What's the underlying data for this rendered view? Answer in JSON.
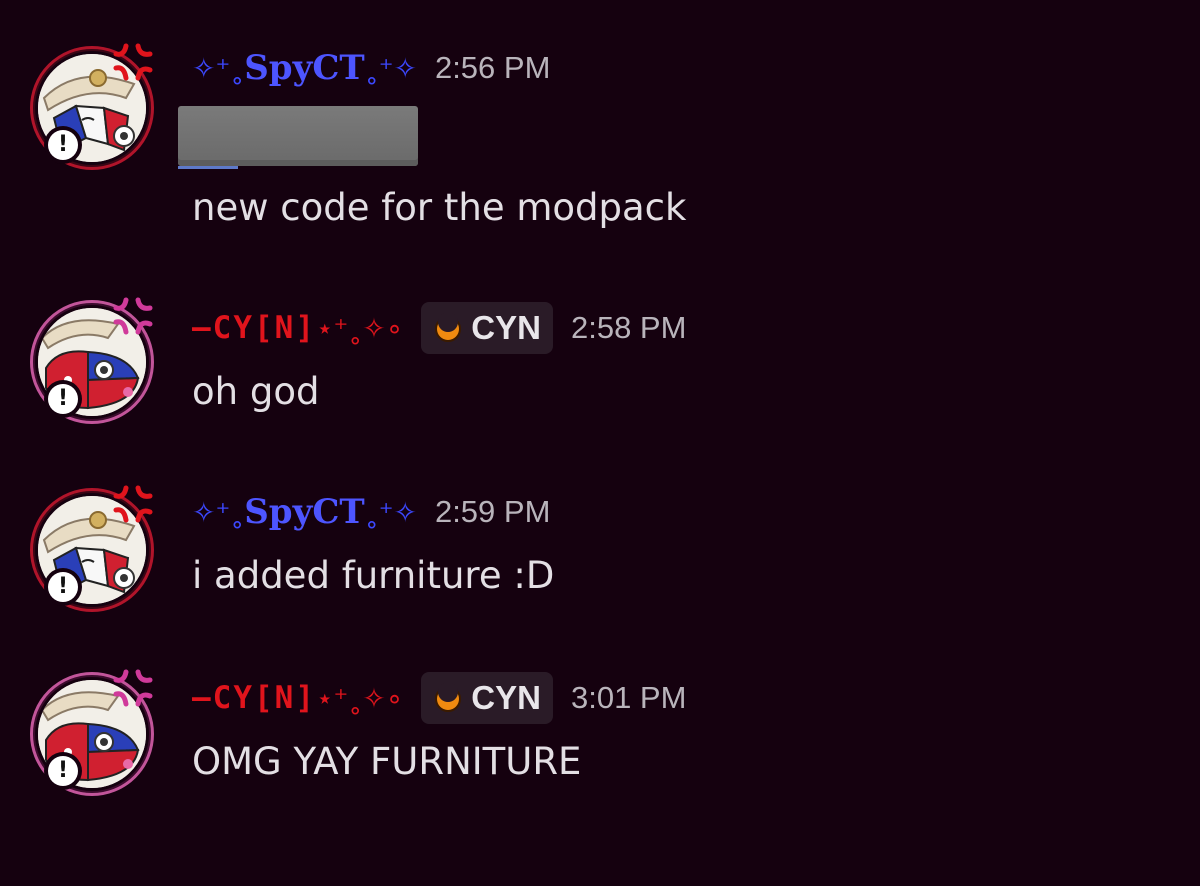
{
  "colors": {
    "background": "#15010f",
    "spyct_name": "#4d55ff",
    "cyn_name": "#e0141c",
    "message_text": "#e3dfe4",
    "timestamp": "#b9b4bb",
    "tag_bg": "#2a1b27"
  },
  "messages": [
    {
      "author_prefix": "✧⁺˳",
      "author_name": "SpyCT",
      "author_suffix": "˳⁺✧",
      "timestamp": "2:56 PM",
      "content": "new code for the modpack",
      "has_redacted_block": true
    },
    {
      "author_name": "—CY[N]",
      "author_suffix": "⋆⁺˳✧∘",
      "tag_label": "CYN",
      "tag_icon": "moon-icon",
      "timestamp": "2:58 PM",
      "content": "oh god"
    },
    {
      "author_prefix": "✧⁺˳",
      "author_name": "SpyCT",
      "author_suffix": "˳⁺✧",
      "timestamp": "2:59 PM",
      "content": "i added furniture :D"
    },
    {
      "author_name": "—CY[N]",
      "author_suffix": "⋆⁺˳✧∘",
      "tag_label": "CYN",
      "tag_icon": "moon-icon",
      "timestamp": "3:01 PM",
      "content": "OMG YAY FURNITURE"
    }
  ]
}
